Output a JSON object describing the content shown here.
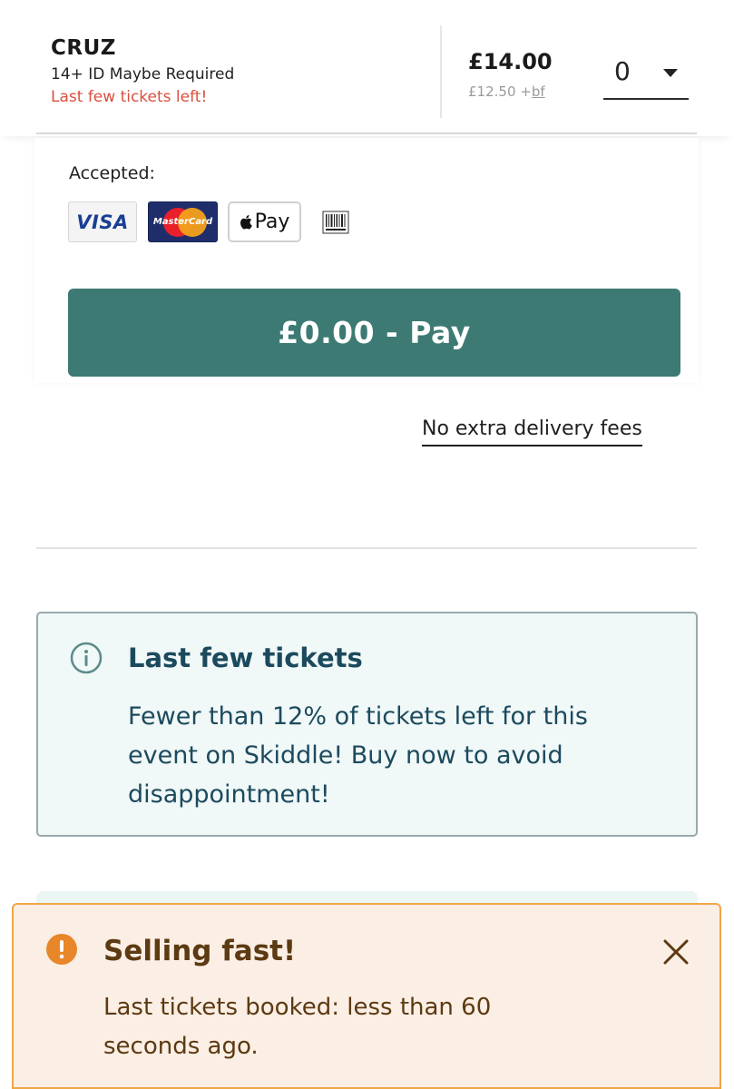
{
  "ticket": {
    "name": "CRUZ",
    "age_note": "14+ ID Maybe Required",
    "stock_note": "Last few tickets left!",
    "price": "£14.00",
    "base_price": "£12.50 +",
    "booking_fee_abbr": "bf",
    "quantity": "0"
  },
  "payment": {
    "accepted_label": "Accepted:",
    "cards": {
      "visa": "VISA",
      "mastercard": "MasterCard",
      "applepay": "Pay"
    },
    "pay_button": "£0.00 - Pay",
    "delivery_link": "No extra delivery fees"
  },
  "info": {
    "title": "Last few tickets",
    "body": "Fewer than 12% of tickets left for this event on Skiddle! Buy now to avoid disappointment!"
  },
  "toast": {
    "title": "Selling fast!",
    "body": "Last tickets booked: less than 60 seconds ago."
  },
  "colors": {
    "accent_teal": "#3d7a74",
    "warning_red": "#d9503f",
    "info_bg": "#f0f8f8",
    "info_text": "#1c4a5d",
    "toast_bg": "#fbeee4",
    "toast_border": "#f0a646",
    "toast_icon": "#e8862a"
  },
  "icons": [
    "info-icon",
    "alert-icon",
    "close-icon",
    "barcode-icon",
    "chevron-down-icon",
    "apple-icon"
  ]
}
